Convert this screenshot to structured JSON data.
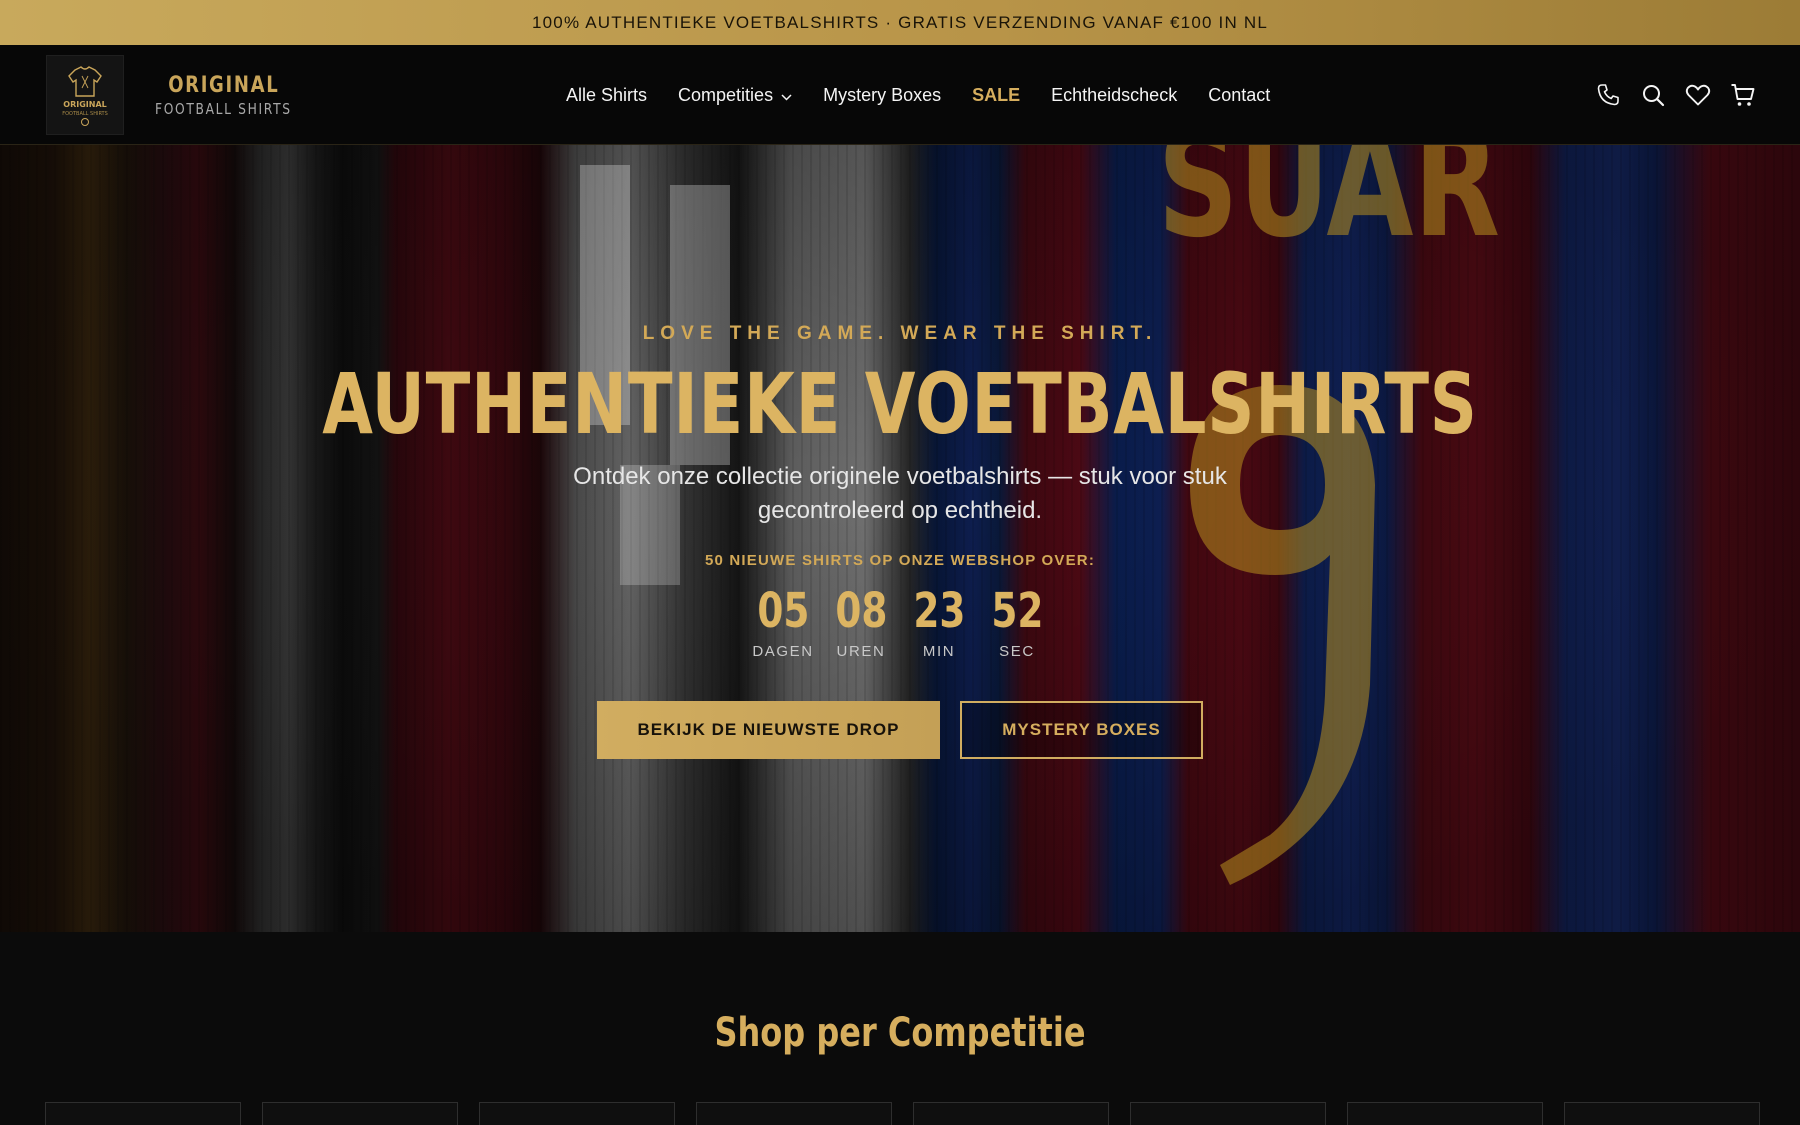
{
  "announcement": "100% AUTHENTIEKE VOETBALSHIRTS · GRATIS VERZENDING VANAF €100 IN NL",
  "logo": {
    "word1": "ORIGINAL",
    "word2": "FOOTBALL SHIRTS",
    "badge_text": "ORIGINAL FOOTBALL SHIRTS",
    "accent": "#c9a55a"
  },
  "nav": {
    "items": [
      {
        "label": "Alle Shirts"
      },
      {
        "label": "Competities",
        "dropdown": true
      },
      {
        "label": "Mystery Boxes"
      },
      {
        "label": "SALE",
        "highlight": true
      },
      {
        "label": "Echtheidscheck"
      },
      {
        "label": "Contact"
      }
    ]
  },
  "header_icons": [
    "phone-icon",
    "search-icon",
    "heart-icon",
    "cart-icon"
  ],
  "hero": {
    "tagline": "LOVE THE GAME. WEAR THE SHIRT.",
    "title": "AUTHENTIEKE VOETBALSHIRTS",
    "subtitle": "Ontdek onze collectie originele voetbalshirts — stuk voor stuk gecontroleerd op echtheid.",
    "countdown_label": "50 NIEUWE SHIRTS OP ONZE WEBSHOP OVER:",
    "countdown": [
      {
        "value": "05",
        "unit": "DAGEN"
      },
      {
        "value": "08",
        "unit": "UREN"
      },
      {
        "value": "23",
        "unit": "MIN"
      },
      {
        "value": "52",
        "unit": "SEC"
      }
    ],
    "primary_button": "BEKIJK DE NIEUWSTE DROP",
    "secondary_button": "MYSTERY BOXES",
    "background_shirt_text": "SUAREZ"
  },
  "section": {
    "title": "Shop per Competitie"
  },
  "colors": {
    "gold": "#d6ae5e",
    "background": "#0b0b0b",
    "header": "#070707"
  }
}
